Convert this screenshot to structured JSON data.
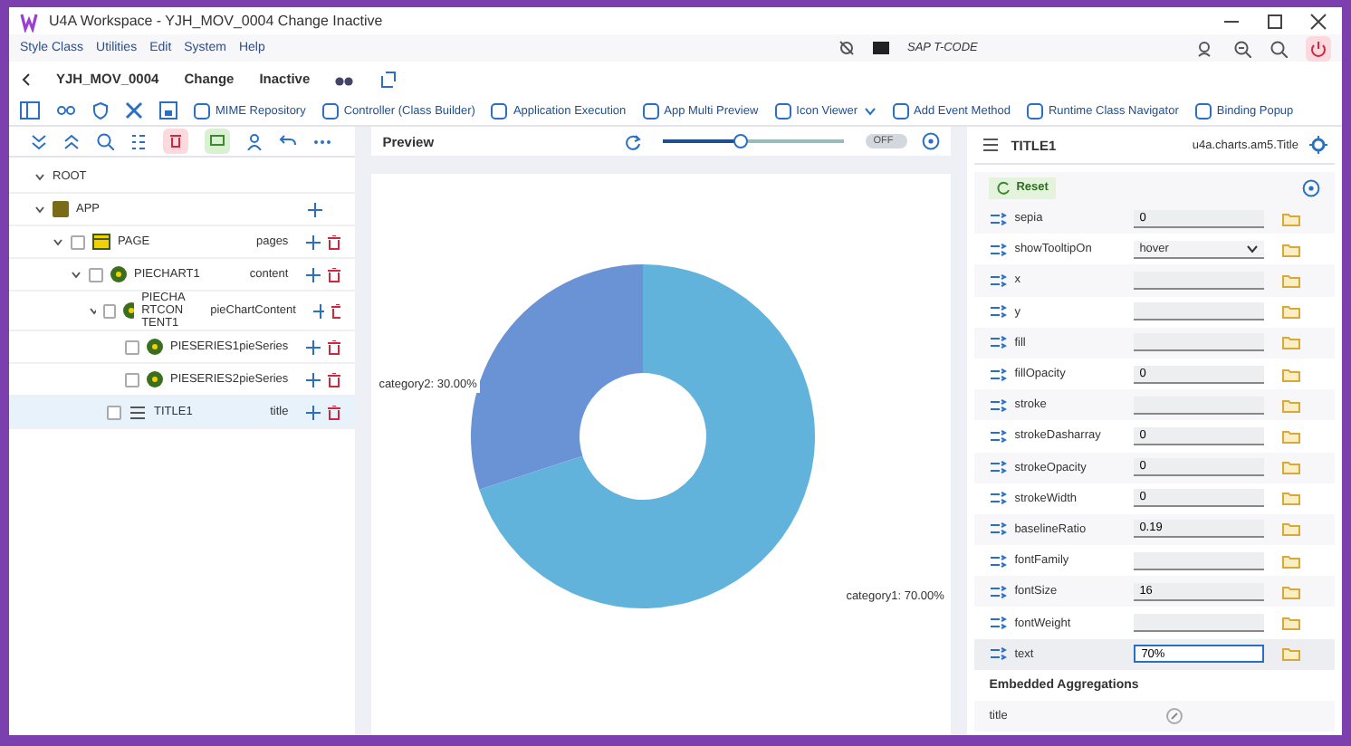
{
  "window": {
    "title": "U4A Workspace - YJH_MOV_0004 Change Inactive"
  },
  "menu": [
    "Style Class",
    "Utilities",
    "Edit",
    "System",
    "Help"
  ],
  "header": {
    "app": "YJH_MOV_0004",
    "mode": "Change",
    "status": "Inactive",
    "tcode_placeholder": "SAP T-CODE"
  },
  "toolbar": [
    "MIME Repository",
    "Controller (Class Builder)",
    "Application Execution",
    "App Multi Preview",
    "Icon Viewer",
    "Add Event Method",
    "Runtime Class Navigator",
    "Binding Popup"
  ],
  "tree": {
    "root": "ROOT",
    "children": [
      {
        "name": "APP",
        "selected": false,
        "children": [
          {
            "name": "PAGE",
            "agg": "pages",
            "selected": false,
            "checked": false,
            "children": [
              {
                "name": "PIECHART1",
                "agg": "content",
                "selected": false,
                "checked": false,
                "children": [
                  {
                    "name": "PIECHA RTCON TENT1",
                    "agg": "pieChartContent",
                    "selected": false,
                    "checked": false,
                    "children": [
                      {
                        "name": "PIESERIES1",
                        "agg": "pieSeries",
                        "selected": false,
                        "checked": false
                      },
                      {
                        "name": "PIESERIES2",
                        "agg": "pieSeries",
                        "selected": false,
                        "checked": false
                      }
                    ]
                  },
                  {
                    "name": "TITLE1",
                    "agg": "title",
                    "selected": true,
                    "checked": false
                  }
                ]
              }
            ]
          }
        ]
      }
    ]
  },
  "preview": {
    "title": "Preview",
    "zoom": {
      "level": 0.42
    },
    "toggle": {
      "label": "OFF",
      "on": false
    },
    "chart_data": {
      "type": "donut",
      "categories": [
        "category1",
        "category2"
      ],
      "values": [
        70,
        30
      ],
      "value_labels": [
        "70.00%",
        "30.00%"
      ]
    }
  },
  "properties": {
    "title": "TITLE1",
    "class": "u4a.charts.am5.Title",
    "reset": "Reset",
    "rows": [
      {
        "name": "sepia",
        "kind": "input",
        "value": "0"
      },
      {
        "name": "showTooltipOn",
        "kind": "select",
        "value": "hover"
      },
      {
        "name": "x",
        "kind": "input"
      },
      {
        "name": "y",
        "kind": "input"
      },
      {
        "name": "fill",
        "kind": "input"
      },
      {
        "name": "fillOpacity",
        "kind": "input",
        "value": "0"
      },
      {
        "name": "stroke",
        "kind": "input"
      },
      {
        "name": "strokeDasharray",
        "kind": "input",
        "value": "0"
      },
      {
        "name": "strokeOpacity",
        "kind": "input",
        "value": "0"
      },
      {
        "name": "strokeWidth",
        "kind": "input",
        "value": "0"
      },
      {
        "name": "baselineRatio",
        "kind": "input",
        "value": "0.19"
      },
      {
        "name": "fontFamily",
        "kind": "input"
      },
      {
        "name": "fontSize",
        "kind": "input",
        "value": "16"
      },
      {
        "name": "fontWeight",
        "kind": "input"
      },
      {
        "name": "text",
        "kind": "input",
        "value": "70%",
        "focused": true
      }
    ],
    "section": "Embedded Aggregations",
    "aggregation": "title"
  }
}
